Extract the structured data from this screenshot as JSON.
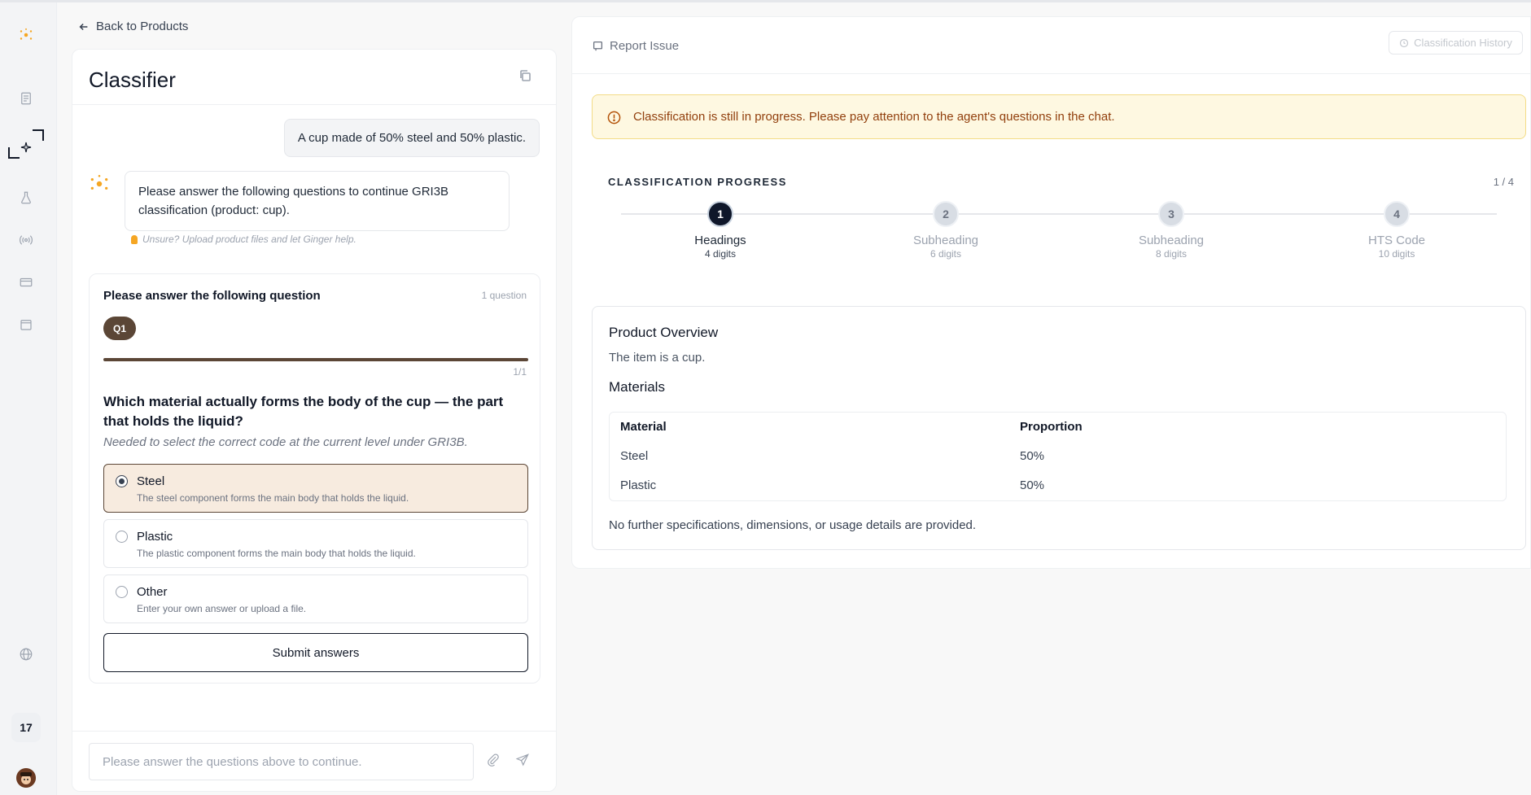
{
  "sidebar": {
    "items": [
      {
        "name": "logo-icon"
      },
      {
        "name": "document-icon"
      },
      {
        "name": "classifier-sparkle-icon",
        "active": true
      },
      {
        "name": "flask-icon"
      },
      {
        "name": "broadcast-icon"
      },
      {
        "name": "card-icon"
      },
      {
        "name": "calendar-icon"
      },
      {
        "name": "globe-icon"
      }
    ],
    "badge": "17"
  },
  "left": {
    "back_label": "Back to Products",
    "title": "Classifier",
    "user_message": "A cup made of 50% steel and 50% plastic.",
    "agent_message": "Please answer the following questions to continue GRI3B classification (product: cup).",
    "unsure_hint": "Unsure? Upload product files and let Ginger help.",
    "question_card": {
      "heading": "Please answer the following question",
      "count": "1 question",
      "pill": "Q1",
      "progress": "1/1",
      "progress_fraction": 1.0,
      "question": "Which material actually forms the body of the cup — the part that holds the liquid?",
      "hint": "Needed to select the correct code at the current level under GRI3B.",
      "options": [
        {
          "label": "Steel",
          "desc": "The steel component forms the main body that holds the liquid.",
          "selected": true
        },
        {
          "label": "Plastic",
          "desc": "The plastic component forms the main body that holds the liquid.",
          "selected": false
        },
        {
          "label": "Other",
          "desc": "Enter your own answer or upload a file.",
          "selected": false
        }
      ],
      "submit_label": "Submit answers"
    },
    "chat_input_placeholder": "Please answer the questions above to continue."
  },
  "right": {
    "report_issue": "Report Issue",
    "history_label": "Classification History",
    "alert": "Classification is still in progress. Please pay attention to the agent's questions in the chat.",
    "progress": {
      "title": "CLASSIFICATION PROGRESS",
      "count": "1 / 4",
      "steps": [
        {
          "num": "1",
          "label": "Headings",
          "sub": "4 digits",
          "active": true
        },
        {
          "num": "2",
          "label": "Subheading",
          "sub": "6 digits",
          "active": false
        },
        {
          "num": "3",
          "label": "Subheading",
          "sub": "8 digits",
          "active": false
        },
        {
          "num": "4",
          "label": "HTS Code",
          "sub": "10 digits",
          "active": false
        }
      ]
    },
    "overview": {
      "title": "Product Overview",
      "text": "The item is a cup.",
      "materials_title": "Materials",
      "table_headers": [
        "Material",
        "Proportion"
      ],
      "rows": [
        [
          "Steel",
          "50%"
        ],
        [
          "Plastic",
          "50%"
        ]
      ],
      "footer": "No further specifications, dimensions, or usage details are provided."
    }
  },
  "colors": {
    "accent_brown": "#5b4636",
    "selected_bg": "#f7ebdf",
    "alert_bg": "#fef8e1",
    "alert_text": "#92400e",
    "active_step": "#0f172a",
    "logo_orange": "#f5a623"
  }
}
